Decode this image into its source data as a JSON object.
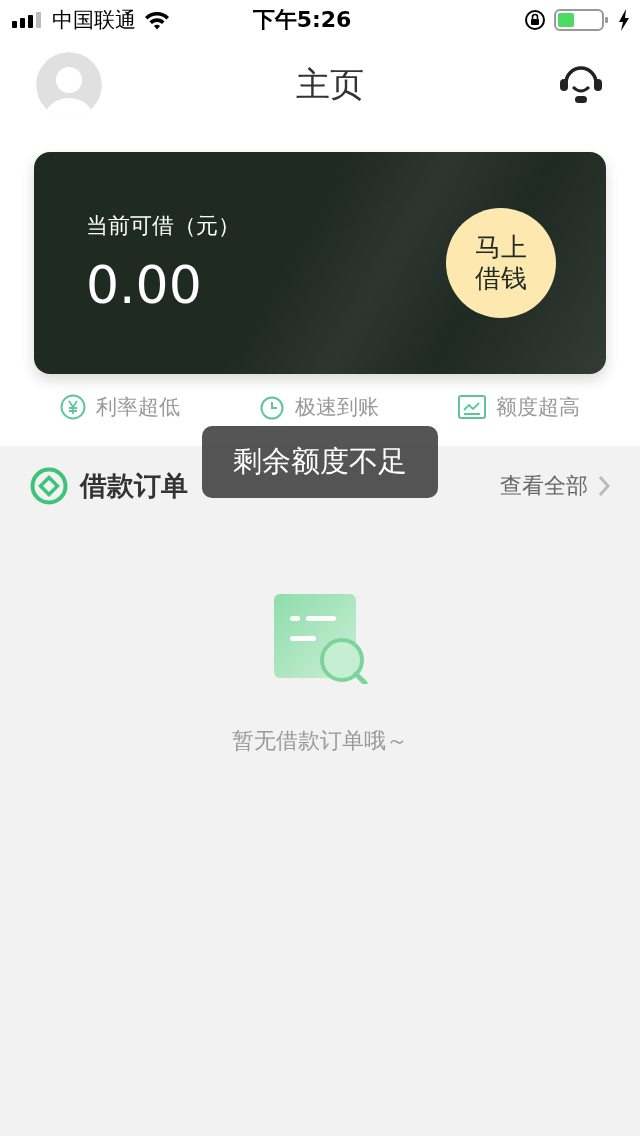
{
  "status_bar": {
    "carrier": "中国联通",
    "time": "下午5:26"
  },
  "header": {
    "title": "主页"
  },
  "card": {
    "label": "当前可借（元）",
    "amount": "0.00",
    "button": "马上借钱"
  },
  "features": [
    {
      "kind": "yen",
      "label": "利率超低"
    },
    {
      "kind": "clock",
      "label": "极速到账"
    },
    {
      "kind": "chart",
      "label": "额度超高"
    }
  ],
  "orders": {
    "title": "借款订单",
    "link": "查看全部",
    "empty_text": "暂无借款订单哦～"
  },
  "toast": "剩余额度不足"
}
